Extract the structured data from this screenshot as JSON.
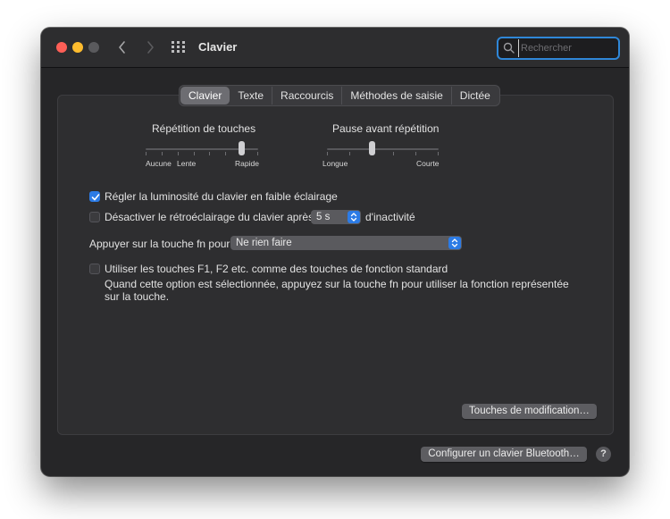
{
  "window": {
    "title": "Clavier"
  },
  "search": {
    "placeholder": "Rechercher"
  },
  "icons": {
    "close": "close-dot-icon",
    "minimize": "minimize-dot-icon",
    "maximize": "maximize-dot-icon",
    "back": "chevron-left-icon",
    "forward": "chevron-right-icon",
    "show_all": "grid-icon",
    "search": "magnifier-icon"
  },
  "tabs": [
    {
      "label": "Clavier",
      "active": true
    },
    {
      "label": "Texte",
      "active": false
    },
    {
      "label": "Raccourcis",
      "active": false
    },
    {
      "label": "Méthodes de saisie",
      "active": false
    },
    {
      "label": "Dictée",
      "active": false
    }
  ],
  "key_repeat": {
    "title": "Répétition de touches",
    "labels": [
      "Aucune",
      "Lente",
      "Rapide"
    ],
    "value": 6,
    "max": 7
  },
  "repeat_delay": {
    "title": "Pause avant répétition",
    "labels": [
      "Longue",
      "Courte"
    ],
    "value": 2,
    "max": 5
  },
  "options": {
    "adjust_brightness": {
      "label": "Régler la luminosité du clavier en faible éclairage",
      "checked": true
    },
    "backlight_off": {
      "label": "Désactiver le rétroéclairage du clavier après",
      "checked": false,
      "duration": "5 s",
      "suffix": "d'inactivité"
    },
    "fn_key": {
      "label": "Appuyer sur la touche fn pour",
      "value": "Ne rien faire"
    },
    "function_keys": {
      "label": "Utiliser les touches F1, F2 etc. comme des touches de fonction standard",
      "checked": false,
      "description": "Quand cette option est sélectionnée, appuyez sur la touche fn pour utiliser la fonction représentée sur la touche."
    }
  },
  "buttons": {
    "modifier_keys": "Touches de modification…",
    "bluetooth": "Configurer un clavier Bluetooth…",
    "help": "?"
  },
  "colors": {
    "accent": "#2c7be5",
    "window_bg": "#262628",
    "close": "#fe5f57",
    "minimize": "#febc2e",
    "maximize_disabled": "#5a5a5d"
  }
}
